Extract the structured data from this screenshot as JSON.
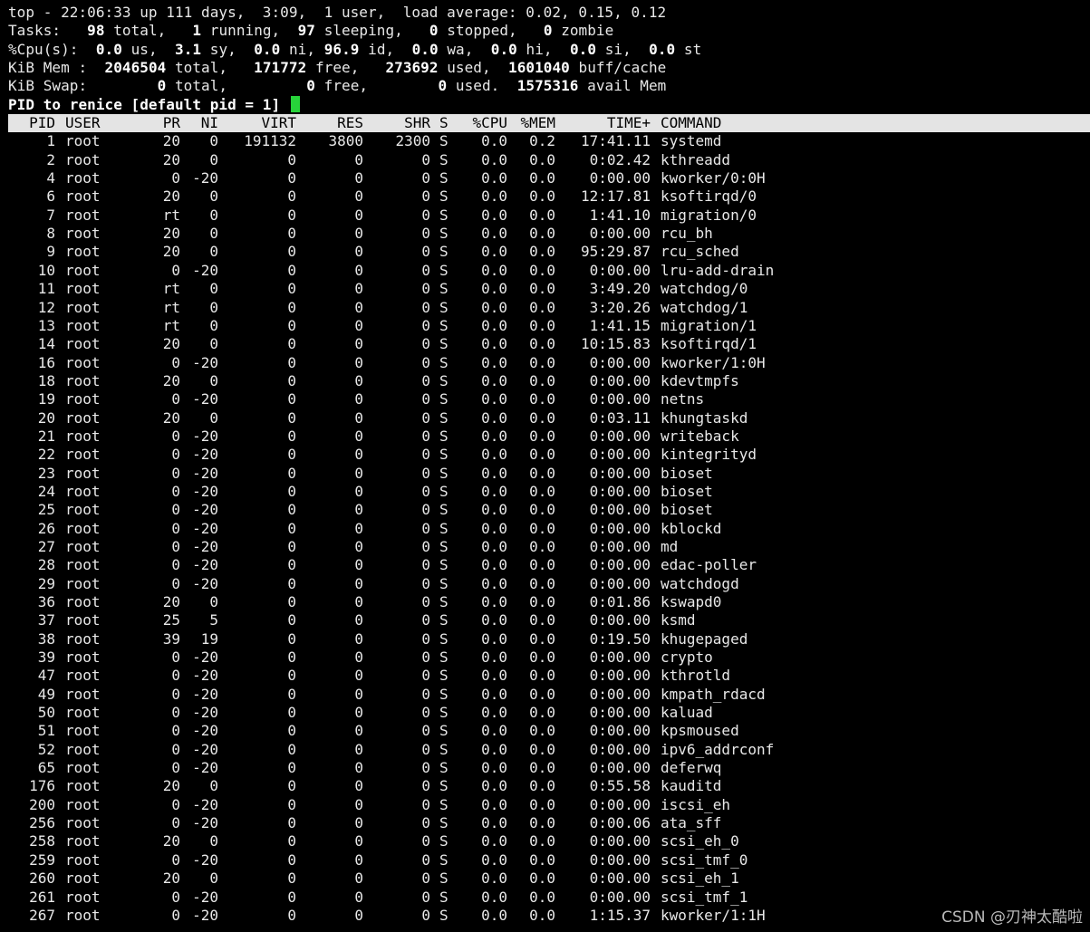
{
  "summary": {
    "uptime_line": "top - 22:06:33 up 111 days,  3:09,  1 user,  load average: 0.02, 0.15, 0.12",
    "tasks": {
      "label": "Tasks:",
      "total": "98",
      "total_label": "total,",
      "running": "1",
      "running_label": "running,",
      "sleeping": "97",
      "sleeping_label": "sleeping,",
      "stopped": "0",
      "stopped_label": "stopped,",
      "zombie": "0",
      "zombie_label": "zombie"
    },
    "cpu": {
      "label": "%Cpu(s):",
      "us": "0.0",
      "us_label": "us,",
      "sy": "3.1",
      "sy_label": "sy,",
      "ni": "0.0",
      "ni_label": "ni,",
      "id": "96.9",
      "id_label": "id,",
      "wa": "0.0",
      "wa_label": "wa,",
      "hi": "0.0",
      "hi_label": "hi,",
      "si": "0.0",
      "si_label": "si,",
      "st": "0.0",
      "st_label": "st"
    },
    "mem": {
      "label": "KiB Mem :",
      "total": "2046504",
      "total_label": "total,",
      "free": "171772",
      "free_label": "free,",
      "used": "273692",
      "used_label": "used,",
      "buff": "1601040",
      "buff_label": "buff/cache"
    },
    "swap": {
      "label": "KiB Swap:",
      "total": "0",
      "total_label": "total,",
      "free": "0",
      "free_label": "free,",
      "used": "0",
      "used_label": "used.",
      "avail": "1575316",
      "avail_label": "avail Mem"
    }
  },
  "prompt": "PID to renice [default pid = 1]",
  "colors": {
    "cursor": "#27d33a",
    "header_bg": "#e4e4e4",
    "background": "#000000"
  },
  "columns": [
    "PID",
    "USER",
    "PR",
    "NI",
    "VIRT",
    "RES",
    "SHR",
    "S",
    "%CPU",
    "%MEM",
    "TIME+",
    "COMMAND"
  ],
  "processes": [
    [
      "1",
      "root",
      "20",
      "0",
      "191132",
      "3800",
      "2300",
      "S",
      "0.0",
      "0.2",
      "17:41.11",
      "systemd"
    ],
    [
      "2",
      "root",
      "20",
      "0",
      "0",
      "0",
      "0",
      "S",
      "0.0",
      "0.0",
      "0:02.42",
      "kthreadd"
    ],
    [
      "4",
      "root",
      "0",
      "-20",
      "0",
      "0",
      "0",
      "S",
      "0.0",
      "0.0",
      "0:00.00",
      "kworker/0:0H"
    ],
    [
      "6",
      "root",
      "20",
      "0",
      "0",
      "0",
      "0",
      "S",
      "0.0",
      "0.0",
      "12:17.81",
      "ksoftirqd/0"
    ],
    [
      "7",
      "root",
      "rt",
      "0",
      "0",
      "0",
      "0",
      "S",
      "0.0",
      "0.0",
      "1:41.10",
      "migration/0"
    ],
    [
      "8",
      "root",
      "20",
      "0",
      "0",
      "0",
      "0",
      "S",
      "0.0",
      "0.0",
      "0:00.00",
      "rcu_bh"
    ],
    [
      "9",
      "root",
      "20",
      "0",
      "0",
      "0",
      "0",
      "S",
      "0.0",
      "0.0",
      "95:29.87",
      "rcu_sched"
    ],
    [
      "10",
      "root",
      "0",
      "-20",
      "0",
      "0",
      "0",
      "S",
      "0.0",
      "0.0",
      "0:00.00",
      "lru-add-drain"
    ],
    [
      "11",
      "root",
      "rt",
      "0",
      "0",
      "0",
      "0",
      "S",
      "0.0",
      "0.0",
      "3:49.20",
      "watchdog/0"
    ],
    [
      "12",
      "root",
      "rt",
      "0",
      "0",
      "0",
      "0",
      "S",
      "0.0",
      "0.0",
      "3:20.26",
      "watchdog/1"
    ],
    [
      "13",
      "root",
      "rt",
      "0",
      "0",
      "0",
      "0",
      "S",
      "0.0",
      "0.0",
      "1:41.15",
      "migration/1"
    ],
    [
      "14",
      "root",
      "20",
      "0",
      "0",
      "0",
      "0",
      "S",
      "0.0",
      "0.0",
      "10:15.83",
      "ksoftirqd/1"
    ],
    [
      "16",
      "root",
      "0",
      "-20",
      "0",
      "0",
      "0",
      "S",
      "0.0",
      "0.0",
      "0:00.00",
      "kworker/1:0H"
    ],
    [
      "18",
      "root",
      "20",
      "0",
      "0",
      "0",
      "0",
      "S",
      "0.0",
      "0.0",
      "0:00.00",
      "kdevtmpfs"
    ],
    [
      "19",
      "root",
      "0",
      "-20",
      "0",
      "0",
      "0",
      "S",
      "0.0",
      "0.0",
      "0:00.00",
      "netns"
    ],
    [
      "20",
      "root",
      "20",
      "0",
      "0",
      "0",
      "0",
      "S",
      "0.0",
      "0.0",
      "0:03.11",
      "khungtaskd"
    ],
    [
      "21",
      "root",
      "0",
      "-20",
      "0",
      "0",
      "0",
      "S",
      "0.0",
      "0.0",
      "0:00.00",
      "writeback"
    ],
    [
      "22",
      "root",
      "0",
      "-20",
      "0",
      "0",
      "0",
      "S",
      "0.0",
      "0.0",
      "0:00.00",
      "kintegrityd"
    ],
    [
      "23",
      "root",
      "0",
      "-20",
      "0",
      "0",
      "0",
      "S",
      "0.0",
      "0.0",
      "0:00.00",
      "bioset"
    ],
    [
      "24",
      "root",
      "0",
      "-20",
      "0",
      "0",
      "0",
      "S",
      "0.0",
      "0.0",
      "0:00.00",
      "bioset"
    ],
    [
      "25",
      "root",
      "0",
      "-20",
      "0",
      "0",
      "0",
      "S",
      "0.0",
      "0.0",
      "0:00.00",
      "bioset"
    ],
    [
      "26",
      "root",
      "0",
      "-20",
      "0",
      "0",
      "0",
      "S",
      "0.0",
      "0.0",
      "0:00.00",
      "kblockd"
    ],
    [
      "27",
      "root",
      "0",
      "-20",
      "0",
      "0",
      "0",
      "S",
      "0.0",
      "0.0",
      "0:00.00",
      "md"
    ],
    [
      "28",
      "root",
      "0",
      "-20",
      "0",
      "0",
      "0",
      "S",
      "0.0",
      "0.0",
      "0:00.00",
      "edac-poller"
    ],
    [
      "29",
      "root",
      "0",
      "-20",
      "0",
      "0",
      "0",
      "S",
      "0.0",
      "0.0",
      "0:00.00",
      "watchdogd"
    ],
    [
      "36",
      "root",
      "20",
      "0",
      "0",
      "0",
      "0",
      "S",
      "0.0",
      "0.0",
      "0:01.86",
      "kswapd0"
    ],
    [
      "37",
      "root",
      "25",
      "5",
      "0",
      "0",
      "0",
      "S",
      "0.0",
      "0.0",
      "0:00.00",
      "ksmd"
    ],
    [
      "38",
      "root",
      "39",
      "19",
      "0",
      "0",
      "0",
      "S",
      "0.0",
      "0.0",
      "0:19.50",
      "khugepaged"
    ],
    [
      "39",
      "root",
      "0",
      "-20",
      "0",
      "0",
      "0",
      "S",
      "0.0",
      "0.0",
      "0:00.00",
      "crypto"
    ],
    [
      "47",
      "root",
      "0",
      "-20",
      "0",
      "0",
      "0",
      "S",
      "0.0",
      "0.0",
      "0:00.00",
      "kthrotld"
    ],
    [
      "49",
      "root",
      "0",
      "-20",
      "0",
      "0",
      "0",
      "S",
      "0.0",
      "0.0",
      "0:00.00",
      "kmpath_rdacd"
    ],
    [
      "50",
      "root",
      "0",
      "-20",
      "0",
      "0",
      "0",
      "S",
      "0.0",
      "0.0",
      "0:00.00",
      "kaluad"
    ],
    [
      "51",
      "root",
      "0",
      "-20",
      "0",
      "0",
      "0",
      "S",
      "0.0",
      "0.0",
      "0:00.00",
      "kpsmoused"
    ],
    [
      "52",
      "root",
      "0",
      "-20",
      "0",
      "0",
      "0",
      "S",
      "0.0",
      "0.0",
      "0:00.00",
      "ipv6_addrconf"
    ],
    [
      "65",
      "root",
      "0",
      "-20",
      "0",
      "0",
      "0",
      "S",
      "0.0",
      "0.0",
      "0:00.00",
      "deferwq"
    ],
    [
      "176",
      "root",
      "20",
      "0",
      "0",
      "0",
      "0",
      "S",
      "0.0",
      "0.0",
      "0:55.58",
      "kauditd"
    ],
    [
      "200",
      "root",
      "0",
      "-20",
      "0",
      "0",
      "0",
      "S",
      "0.0",
      "0.0",
      "0:00.00",
      "iscsi_eh"
    ],
    [
      "256",
      "root",
      "0",
      "-20",
      "0",
      "0",
      "0",
      "S",
      "0.0",
      "0.0",
      "0:00.06",
      "ata_sff"
    ],
    [
      "258",
      "root",
      "20",
      "0",
      "0",
      "0",
      "0",
      "S",
      "0.0",
      "0.0",
      "0:00.00",
      "scsi_eh_0"
    ],
    [
      "259",
      "root",
      "0",
      "-20",
      "0",
      "0",
      "0",
      "S",
      "0.0",
      "0.0",
      "0:00.00",
      "scsi_tmf_0"
    ],
    [
      "260",
      "root",
      "20",
      "0",
      "0",
      "0",
      "0",
      "S",
      "0.0",
      "0.0",
      "0:00.00",
      "scsi_eh_1"
    ],
    [
      "261",
      "root",
      "0",
      "-20",
      "0",
      "0",
      "0",
      "S",
      "0.0",
      "0.0",
      "0:00.00",
      "scsi_tmf_1"
    ],
    [
      "267",
      "root",
      "0",
      "-20",
      "0",
      "0",
      "0",
      "S",
      "0.0",
      "0.0",
      "1:15.37",
      "kworker/1:1H"
    ]
  ],
  "watermark": "CSDN @刃神太酷啦"
}
